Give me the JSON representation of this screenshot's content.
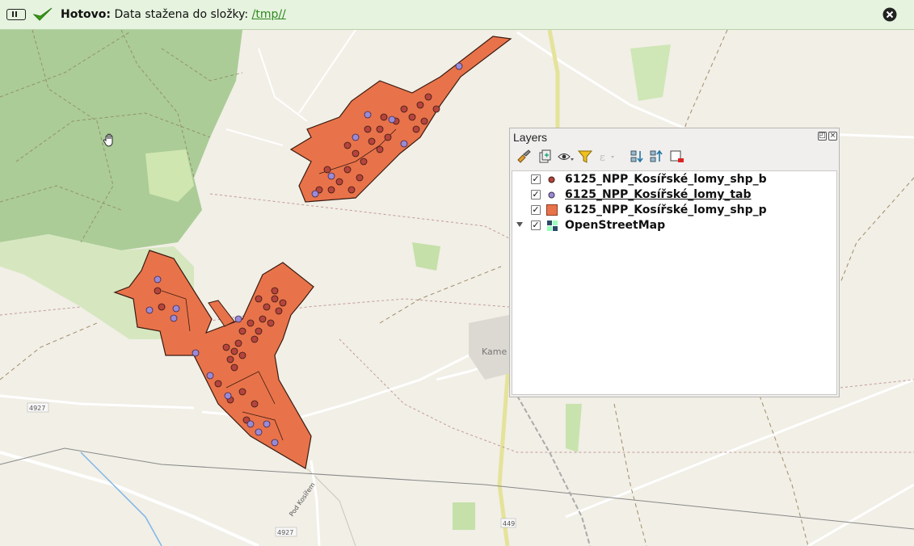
{
  "message_bar": {
    "title": "Hotovo:",
    "text": "Data stažena do složky:",
    "link": "/tmp//"
  },
  "map": {
    "labels": {
      "place": "Kame",
      "road_4927a": "4927",
      "road_4927b": "4927",
      "road_449": "449",
      "street": "Pod Kosířem"
    },
    "colors": {
      "polygon_fill": "#e8734a",
      "polygon_stroke": "#3a1a10",
      "point_b": "#b5443f",
      "point_tab": "#9a8ad6",
      "forest": "#a9cb95",
      "meadow": "#dbe9c4"
    }
  },
  "layers_panel": {
    "title": "Layers",
    "toolbar_icons": [
      "paint-brush-icon",
      "add-group-icon",
      "eye-icon",
      "filter-icon",
      "expression-filter-icon",
      "expand-all-icon",
      "collapse-all-icon",
      "remove-layer-icon"
    ],
    "layers": [
      {
        "name": "6125_NPP_Kosířské_lomy_shp_b",
        "checked": true,
        "symbol": "point-dark-red"
      },
      {
        "name": "6125_NPP_Kosířské_lomy_tab",
        "checked": true,
        "symbol": "point-purple"
      },
      {
        "name": "6125_NPP_Kosířské_lomy_shp_p",
        "checked": true,
        "symbol": "polygon-orange"
      },
      {
        "name": "OpenStreetMap",
        "checked": true,
        "symbol": "raster-icon"
      }
    ]
  }
}
